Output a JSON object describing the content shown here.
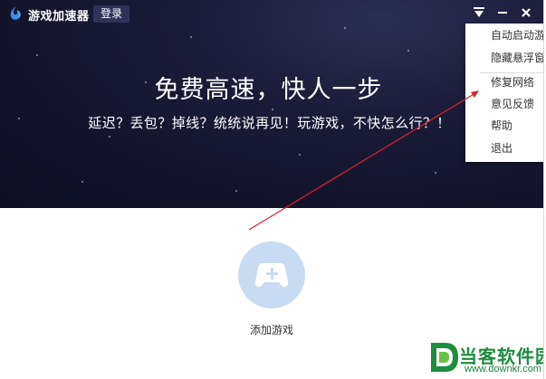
{
  "app": {
    "title": "游戏加速器",
    "login_label": "登录",
    "menu_toggle_icon": "dropdown-triangle-icon",
    "minimize_icon": "minimize-icon",
    "close_icon": "close-icon"
  },
  "hero": {
    "headline": "免费高速，快人一步",
    "subline": "延迟？丢包？掉线？统统说再见！玩游戏，不快怎么行？！"
  },
  "menu": {
    "items": [
      {
        "label": "自动启动游戏"
      },
      {
        "label": "隐藏悬浮窗"
      },
      {
        "label": "修复网络"
      },
      {
        "label": "意见反馈"
      },
      {
        "label": "帮助"
      },
      {
        "label": "退出"
      }
    ]
  },
  "main": {
    "add_game_icon": "gamepad-plus-icon",
    "add_game_label": "添加游戏"
  },
  "watermark": {
    "brand": "当客软件园",
    "url": "www.downkr.com"
  },
  "colors": {
    "hero_bg": "#15162e",
    "add_game_circle": "#c8dbf2",
    "annotation_arrow": "#d9232a",
    "watermark_green": "#1e8d3e"
  }
}
